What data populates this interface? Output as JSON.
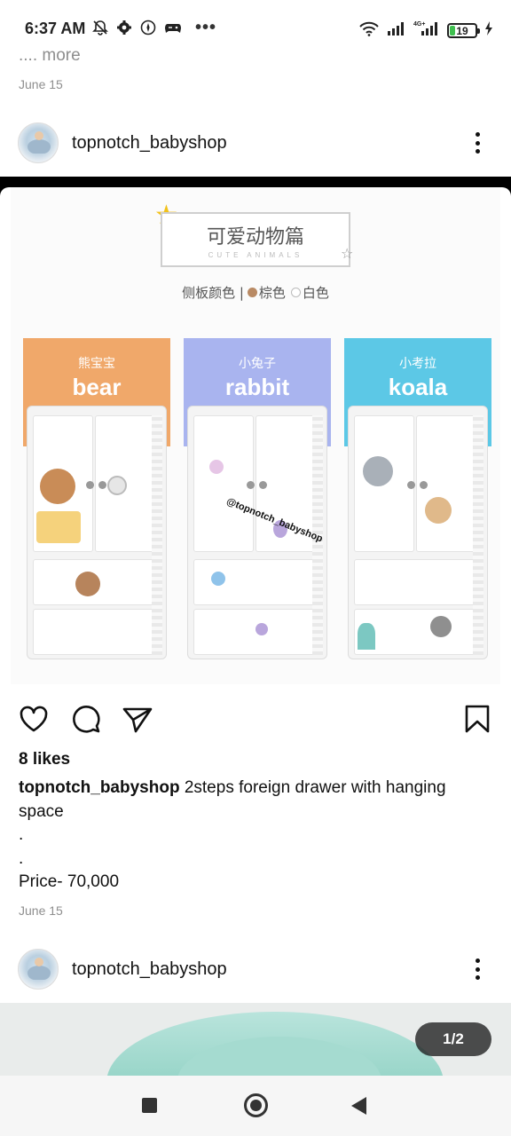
{
  "status_bar": {
    "time": "6:37 AM",
    "dots": "•••",
    "battery_level": "19",
    "network": "4G+",
    "icons_left": [
      "mute-bell-icon",
      "settings-icon",
      "compass-icon",
      "game-icon"
    ],
    "icons_right": [
      "wifi-icon",
      "signal-icon",
      "signal-4g-icon",
      "battery-icon",
      "charging-icon"
    ]
  },
  "previous_post": {
    "more_text": ".... more",
    "date": "June 15"
  },
  "post": {
    "username": "topnotch_babyshop",
    "image": {
      "title_cn": "可爱动物篇",
      "title_en": "CUTE ANIMALS",
      "side_colors_label": "侧板颜色 |",
      "color_brown": "棕色",
      "color_white": "白色",
      "watermark": "@topnotch_babyshop",
      "cabinets": [
        {
          "cn": "熊宝宝",
          "en": "bear",
          "color": "#f0a86a"
        },
        {
          "cn": "小兔子",
          "en": "rabbit",
          "color": "#a9b4ef"
        },
        {
          "cn": "小考拉",
          "en": "koala",
          "color": "#5cc8e6"
        }
      ]
    },
    "likes": "8 likes",
    "caption_user": "topnotch_babyshop",
    "caption_text": " 2steps foreign drawer with hanging space",
    "dot1": ".",
    "dot2": ".",
    "price": "Price- 70,000",
    "date": "June 15"
  },
  "next_post": {
    "username": "topnotch_babyshop",
    "page_indicator": "1/2"
  }
}
